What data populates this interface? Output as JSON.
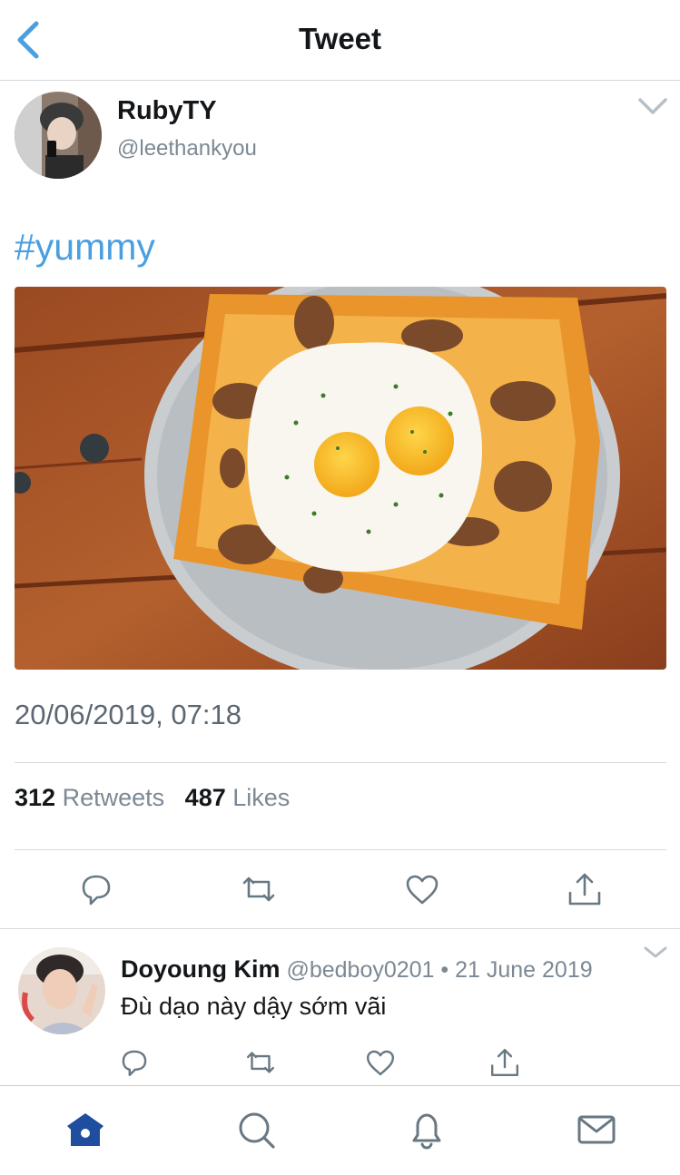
{
  "header": {
    "title": "Tweet"
  },
  "tweet": {
    "display_name": "RubyTY",
    "handle": "@leethankyou",
    "text": "#yummy",
    "timestamp": "20/06/2019, 07:18",
    "retweets_count": "312",
    "retweets_label": "Retweets",
    "likes_count": "487",
    "likes_label": "Likes"
  },
  "reply": {
    "display_name": "Doyoung Kim",
    "handle": "@bedboy0201",
    "date": "• 21 June 2019",
    "text": "Đù dạo này dậy sớm vãi"
  },
  "colors": {
    "accent": "#4a9fe0",
    "icon_gray": "#687883",
    "tab_active": "#1f4e9f",
    "tab_inactive": "#687883"
  },
  "icons": [
    "back-chevron",
    "caret-down",
    "reply",
    "retweet",
    "like",
    "share",
    "home",
    "search",
    "notifications",
    "messages"
  ]
}
